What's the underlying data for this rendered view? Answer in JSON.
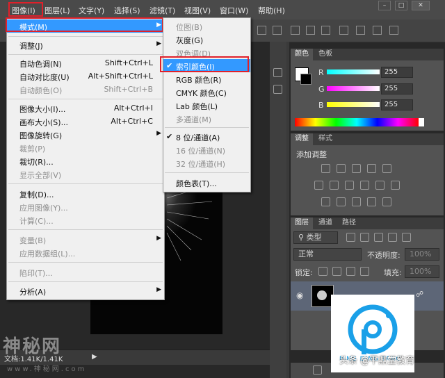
{
  "menubar": {
    "items": [
      "图像(I)",
      "图层(L)",
      "文字(Y)",
      "选择(S)",
      "滤镜(T)",
      "视图(V)",
      "窗口(W)",
      "帮助(H)"
    ]
  },
  "image_menu": {
    "items": [
      {
        "label": "模式(M)",
        "shortcut": "",
        "submenu": true,
        "state": "highlighted"
      },
      {
        "label": "调整(J)",
        "shortcut": "",
        "submenu": true,
        "state": "enabled"
      },
      {
        "label": "自动色调(N)",
        "shortcut": "Shift+Ctrl+L",
        "state": "enabled"
      },
      {
        "label": "自动对比度(U)",
        "shortcut": "Alt+Shift+Ctrl+L",
        "state": "enabled"
      },
      {
        "label": "自动颜色(O)",
        "shortcut": "Shift+Ctrl+B",
        "state": "disabled"
      },
      {
        "label": "图像大小(I)...",
        "shortcut": "Alt+Ctrl+I",
        "state": "enabled"
      },
      {
        "label": "画布大小(S)...",
        "shortcut": "Alt+Ctrl+C",
        "state": "enabled"
      },
      {
        "label": "图像旋转(G)",
        "shortcut": "",
        "submenu": true,
        "state": "enabled"
      },
      {
        "label": "裁剪(P)",
        "shortcut": "",
        "state": "disabled"
      },
      {
        "label": "裁切(R)...",
        "shortcut": "",
        "state": "enabled"
      },
      {
        "label": "显示全部(V)",
        "shortcut": "",
        "state": "disabled"
      },
      {
        "label": "复制(D)...",
        "shortcut": "",
        "state": "enabled"
      },
      {
        "label": "应用图像(Y)...",
        "shortcut": "",
        "state": "disabled"
      },
      {
        "label": "计算(C)...",
        "shortcut": "",
        "state": "disabled"
      },
      {
        "label": "变量(B)",
        "shortcut": "",
        "submenu": true,
        "state": "disabled"
      },
      {
        "label": "应用数据组(L)...",
        "shortcut": "",
        "state": "disabled"
      },
      {
        "label": "陷印(T)...",
        "shortcut": "",
        "state": "disabled"
      },
      {
        "label": "分析(A)",
        "shortcut": "",
        "submenu": true,
        "state": "enabled"
      }
    ]
  },
  "mode_submenu": {
    "items": [
      {
        "label": "位图(B)",
        "state": "disabled",
        "checked": false
      },
      {
        "label": "灰度(G)",
        "state": "enabled",
        "checked": false
      },
      {
        "label": "双色调(D)",
        "state": "disabled",
        "checked": false
      },
      {
        "label": "索引颜色(I)",
        "state": "highlighted",
        "checked": true
      },
      {
        "label": "RGB 颜色(R)",
        "state": "enabled",
        "checked": false
      },
      {
        "label": "CMYK 颜色(C)",
        "state": "enabled",
        "checked": false
      },
      {
        "label": "Lab 颜色(L)",
        "state": "enabled",
        "checked": false
      },
      {
        "label": "多通道(M)",
        "state": "disabled",
        "checked": false
      },
      {
        "label": "8 位/通道(A)",
        "state": "enabled",
        "checked": true
      },
      {
        "label": "16 位/通道(N)",
        "state": "disabled",
        "checked": false
      },
      {
        "label": "32 位/通道(H)",
        "state": "disabled",
        "checked": false
      },
      {
        "label": "颜色表(T)...",
        "state": "enabled",
        "checked": false
      }
    ]
  },
  "color_panel": {
    "tabs": [
      "颜色",
      "色板"
    ],
    "channels": [
      {
        "label": "R",
        "value": "255",
        "gradient_color": "#00ffff"
      },
      {
        "label": "G",
        "value": "255",
        "gradient_color": "#ff00ff"
      },
      {
        "label": "B",
        "value": "255",
        "gradient_color": "#ffff00"
      }
    ]
  },
  "adjust_panel": {
    "tabs": [
      "调整",
      "样式"
    ],
    "title": "添加调整"
  },
  "layers_panel": {
    "tabs": [
      "图层",
      "通道",
      "路径"
    ],
    "filter_kind": "类型",
    "blend_mode": "正常",
    "opacity_label": "不透明度:",
    "opacity_value": "100%",
    "lock_label": "锁定:",
    "fill_label": "填充:",
    "fill_value": "100%"
  },
  "watermarks": {
    "left_main": "神秘网",
    "left_sub": "www.神秘网.com",
    "logo_text": "PING DING TANG",
    "right_text": "头条 @平鼎堂教育"
  },
  "statusbar": {
    "text": "文档:1.41K/1.41K"
  },
  "colors": {
    "menu_highlight": "#3399ff",
    "callout_red": "#e0202a",
    "logo_blue": "#1aa0e8"
  }
}
